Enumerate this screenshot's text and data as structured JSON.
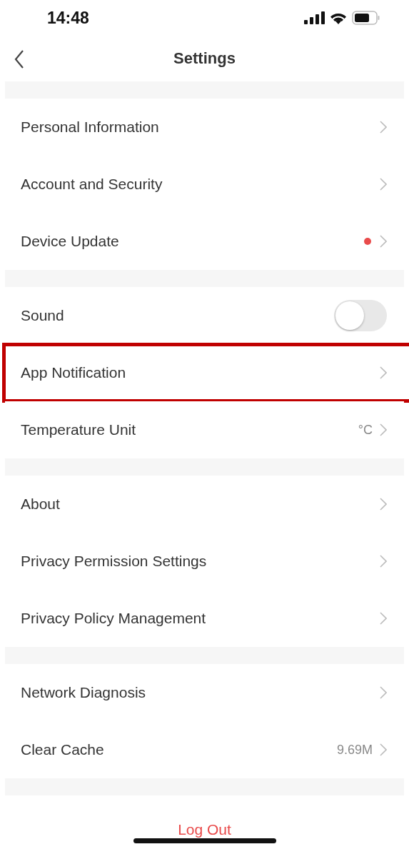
{
  "status_bar": {
    "time": "14:48"
  },
  "nav": {
    "title": "Settings"
  },
  "groups": [
    {
      "items": [
        {
          "label": "Personal Information",
          "kind": "link"
        },
        {
          "label": "Account and Security",
          "kind": "link"
        },
        {
          "label": "Device Update",
          "kind": "link",
          "color": "#e94b4b"
        }
      ]
    },
    {
      "items": [
        {
          "label": "Sound",
          "kind": "toggle",
          "on": false
        },
        {
          "label": "App Notification",
          "kind": "link",
          "highlighted": true
        },
        {
          "label": "Temperature Unit",
          "kind": "link",
          "value": "°C"
        }
      ]
    },
    {
      "items": [
        {
          "label": "About",
          "kind": "link"
        },
        {
          "label": "Privacy Permission Settings",
          "kind": "link"
        },
        {
          "label": "Privacy Policy Management",
          "kind": "link"
        }
      ]
    },
    {
      "items": [
        {
          "label": "Network Diagnosis",
          "kind": "link"
        },
        {
          "label": "Clear Cache",
          "kind": "link",
          "value": "9.69M"
        }
      ]
    }
  ],
  "logout": {
    "label": "Log Out"
  }
}
